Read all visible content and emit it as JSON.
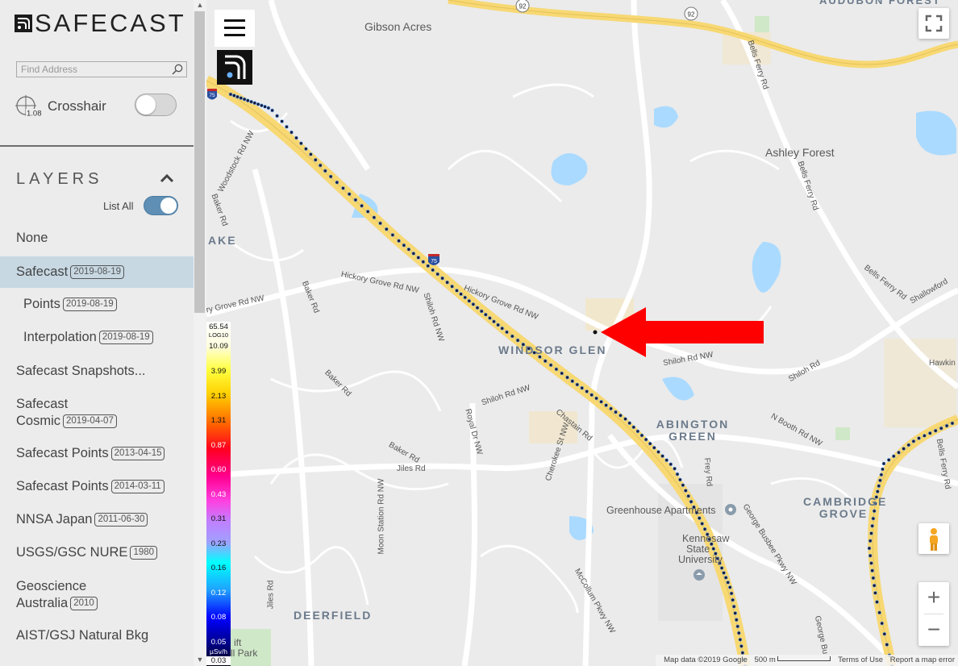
{
  "app": {
    "title": "SAFECAST"
  },
  "search": {
    "placeholder": "Find Address"
  },
  "crosshair": {
    "icon_value": "1.08",
    "label": "Crosshair",
    "enabled": false
  },
  "layers": {
    "heading": "LAYERS",
    "list_all_label": "List All",
    "list_all_enabled": true,
    "items": [
      {
        "label": "None",
        "date": ""
      },
      {
        "label": "Safecast",
        "date": "2019-08-19",
        "active": true
      },
      {
        "label": "Points",
        "date": "2019-08-19"
      },
      {
        "label": "Interpolation",
        "date": "2019-08-19"
      },
      {
        "label": "Safecast Snapshots...",
        "date": ""
      },
      {
        "label": "Safecast",
        "label2": "Cosmic",
        "date": "2019-04-07"
      },
      {
        "label": "Safecast Points",
        "date": "2013-04-15"
      },
      {
        "label": "Safecast Points",
        "date": "2014-03-11"
      },
      {
        "label": "NNSA Japan",
        "date": "2011-06-30"
      },
      {
        "label": "USGS/GSC NURE",
        "date": "1980"
      },
      {
        "label": "Geoscience",
        "label2": "Australia",
        "date": "2010"
      },
      {
        "label": "AIST/GSJ Natural Bkg",
        "date": ""
      }
    ]
  },
  "map": {
    "places": [
      "Gibson Acres",
      "AUDUBON FOREST",
      "Ashley Forest",
      "WINDSOR GLEN",
      "ABINGTON GREEN",
      "CAMBRIDGE GROVE",
      "DEERFIELD",
      "Greenhouse Apartments",
      "Kennesaw",
      "State",
      "University",
      "AKE",
      "Hawkin",
      "Shallowford",
      "ift",
      "ll Park"
    ],
    "roads": [
      "Bells Ferry Rd",
      "Bells Ferry Rd",
      "Woodstock Rd NW",
      "Baker Rd",
      "Hickory Grove Rd NW",
      "Hickory Grove Rd NW",
      "ry Grove Rd NW",
      "Baker Rd",
      "Shiloh Rd NW",
      "Shiloh Rd NW",
      "Shiloh Rd NW",
      "Shiloh Rd",
      "Bells Ferry Rd",
      "Baker Rd",
      "Royal Dr NW",
      "Cherokee St NW",
      "Chastain Rd",
      "Baker Rd",
      "Jiles Rd",
      "Frey Rd",
      "N Booth Rd NW",
      "George Busbee Pkwy NW",
      "Moon Station Rd NW",
      "Jiles Rd",
      "McCollum Pkwy NW",
      "George Bu",
      "Bells Ferry Rd"
    ],
    "shields": [
      "92",
      "92",
      "75",
      "75"
    ],
    "legend": {
      "top_value": "65.54",
      "scale": "LOG10",
      "unit": "µSv/h",
      "ticks": [
        "10.09",
        "3.99",
        "2.13",
        "1.31",
        "0.87",
        "0.60",
        "0.43",
        "0.31",
        "0.23",
        "0.16",
        "0.12",
        "0.08",
        "0.05",
        "0.03"
      ]
    },
    "controls": {
      "zoom_in": "+",
      "zoom_out": "−",
      "fullscreen": "fullscreen",
      "pegman": "pegman"
    },
    "footer": {
      "map_data": "Map data ©2019 Google",
      "scale": "500 m",
      "terms": "Terms of Use",
      "report": "Report a map error"
    },
    "colors": {
      "highway": "#f7d873",
      "water": "#aadaff",
      "track_dot": "#1a1a3a",
      "arrow": "#ff0000",
      "sidebar_active": "#c7d8e3",
      "toggle_on": "#5f8fb5"
    }
  }
}
